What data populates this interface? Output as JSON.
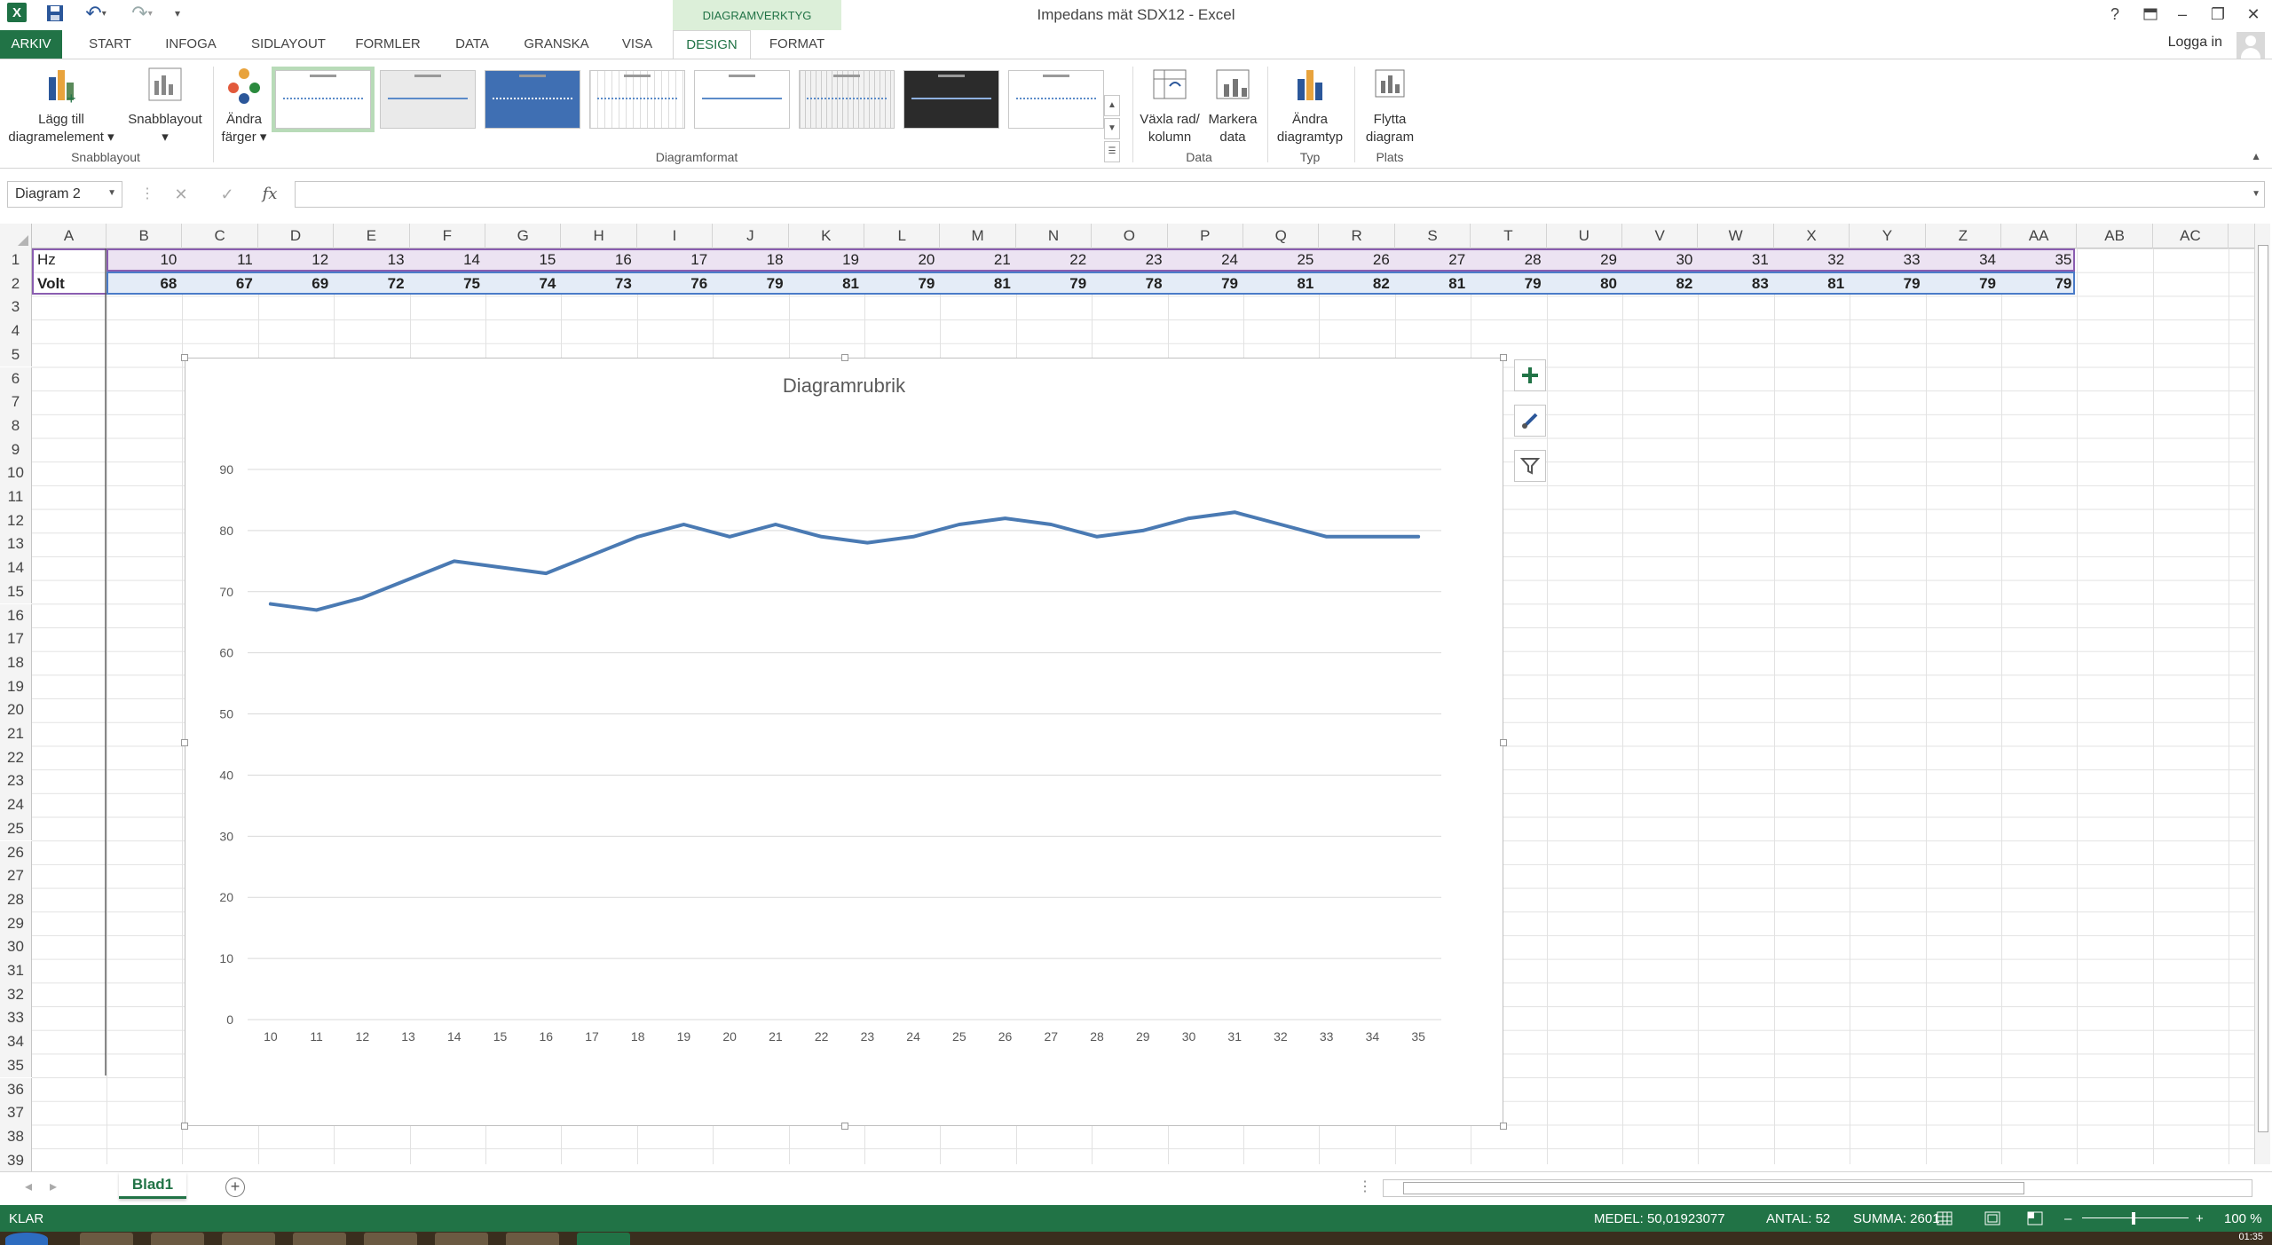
{
  "window": {
    "title": "Impedans mät SDX12 - Excel",
    "context_group": "DIAGRAMVERKTYG",
    "login": "Logga in"
  },
  "qat": {
    "logo": "X"
  },
  "tabs": [
    "ARKIV",
    "START",
    "INFOGA",
    "SIDLAYOUT",
    "FORMLER",
    "DATA",
    "GRANSKA",
    "VISA",
    "DESIGN",
    "FORMAT"
  ],
  "ribbon": {
    "add_element": [
      "Lägg till",
      "diagramelement ▾"
    ],
    "quick_layout": [
      "Snabblayout",
      "▾"
    ],
    "change_colors": [
      "Ändra",
      "färger ▾"
    ],
    "switch_rowcol": [
      "Växla rad/",
      "kolumn"
    ],
    "select_data": [
      "Markera",
      "data"
    ],
    "change_type": [
      "Ändra",
      "diagramtyp"
    ],
    "move_chart": [
      "Flytta",
      "diagram"
    ],
    "groups": {
      "snabblayout": "Snabblayout",
      "diagramformat": "Diagramformat",
      "data": "Data",
      "typ": "Typ",
      "plats": "Plats"
    }
  },
  "formula_bar": {
    "name_box": "Diagram 2",
    "fx": "fx",
    "value": ""
  },
  "columns": [
    "A",
    "B",
    "C",
    "D",
    "E",
    "F",
    "G",
    "H",
    "I",
    "J",
    "K",
    "L",
    "M",
    "N",
    "O",
    "P",
    "Q",
    "R",
    "S",
    "T",
    "U",
    "V",
    "W",
    "X",
    "Y",
    "Z",
    "AA",
    "AB",
    "AC"
  ],
  "rows": [
    "1",
    "2",
    "3",
    "4",
    "5",
    "6",
    "7",
    "8",
    "9",
    "10",
    "11",
    "12",
    "13",
    "14",
    "15",
    "16",
    "17",
    "18",
    "19",
    "20",
    "21",
    "22",
    "23",
    "24",
    "25",
    "26",
    "27",
    "28",
    "29",
    "30",
    "31",
    "32",
    "33",
    "34",
    "35",
    "36",
    "37",
    "38",
    "39"
  ],
  "sheet": {
    "row1_label": "Hz",
    "row2_label": "Volt",
    "hz": [
      "10",
      "11",
      "12",
      "13",
      "14",
      "15",
      "16",
      "17",
      "18",
      "19",
      "20",
      "21",
      "22",
      "23",
      "24",
      "25",
      "26",
      "27",
      "28",
      "29",
      "30",
      "31",
      "32",
      "33",
      "34",
      "35"
    ],
    "volt": [
      "68",
      "67",
      "69",
      "72",
      "75",
      "74",
      "73",
      "76",
      "79",
      "81",
      "79",
      "81",
      "79",
      "78",
      "79",
      "81",
      "82",
      "81",
      "79",
      "80",
      "82",
      "83",
      "81",
      "79",
      "79",
      "79"
    ]
  },
  "chart_data": {
    "type": "line",
    "title": "Diagramrubrik",
    "categories": [
      "10",
      "11",
      "12",
      "13",
      "14",
      "15",
      "16",
      "17",
      "18",
      "19",
      "20",
      "21",
      "22",
      "23",
      "24",
      "25",
      "26",
      "27",
      "28",
      "29",
      "30",
      "31",
      "32",
      "33",
      "34",
      "35"
    ],
    "series": [
      {
        "values": [
          68,
          67,
          69,
          72,
          75,
          74,
          73,
          76,
          79,
          81,
          79,
          81,
          79,
          78,
          79,
          81,
          82,
          81,
          79,
          80,
          82,
          83,
          81,
          79,
          79,
          79
        ],
        "color": "#4a7ab3"
      }
    ],
    "ylim": [
      0,
      90
    ],
    "yticks": [
      0,
      10,
      20,
      30,
      40,
      50,
      60,
      70,
      80,
      90
    ],
    "grid": true
  },
  "sheet_tabs": {
    "active": "Blad1",
    "add": "+"
  },
  "status": {
    "ready": "KLAR",
    "average": "MEDEL: 50,01923077",
    "count": "ANTAL: 52",
    "sum": "SUMMA: 2601",
    "zoom": "100 %"
  },
  "clock": "01:35",
  "colors": {
    "excel_green": "#217346",
    "series_blue": "#4a7ab3",
    "selection_purple": "#8a5db0"
  }
}
